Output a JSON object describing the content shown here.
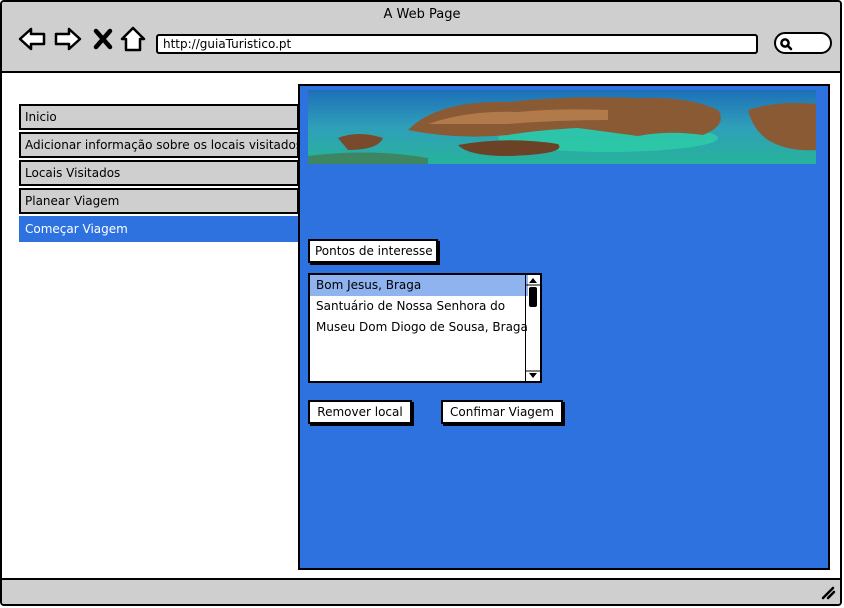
{
  "window": {
    "title": "A Web Page"
  },
  "browser": {
    "url": "http://guiaTuristico.pt"
  },
  "menu": {
    "items": [
      {
        "label": "Inicio"
      },
      {
        "label": "Adicionar informação sobre os locais visitados"
      },
      {
        "label": "Locais Visitados"
      },
      {
        "label": "Planear Viagem"
      },
      {
        "label": "Começar Viagem",
        "active": true
      }
    ]
  },
  "main": {
    "section_label": "Pontos de interesse",
    "points": [
      {
        "label": "Bom Jesus, Braga",
        "selected": true
      },
      {
        "label": "Santuário de Nossa Senhora do"
      },
      {
        "label": "Museu Dom Diogo de Sousa, Braga"
      }
    ],
    "remove_button": "Remover local",
    "confirm_button": "Confimar Viagem"
  },
  "colors": {
    "accent": "#2e72e0",
    "chrome": "#cfcfcf",
    "selection": "#8fb3ee"
  }
}
